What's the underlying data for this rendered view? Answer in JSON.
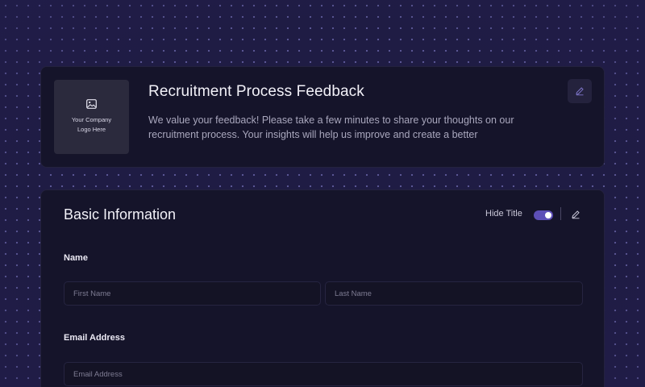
{
  "header": {
    "logo": {
      "icon": "image-icon",
      "line1": "Your Company",
      "line2": "Logo Here"
    },
    "title": "Recruitment Process Feedback",
    "description": "We value your feedback! Please take a few minutes to share your thoughts on our recruitment process. Your insights will help us improve and create a better",
    "edit_icon": "pencil-icon"
  },
  "section": {
    "title": "Basic Information",
    "hide_title_label": "Hide Title",
    "hide_title_on": true,
    "edit_icon": "pencil-icon"
  },
  "fields": {
    "name_label": "Name",
    "first_name_placeholder": "First Name",
    "last_name_placeholder": "Last Name",
    "email_label": "Email Address",
    "email_placeholder": "Email Address"
  },
  "colors": {
    "background": "#1f1c44",
    "card": "#15142a",
    "toggle_accent": "#5d4fb8"
  }
}
